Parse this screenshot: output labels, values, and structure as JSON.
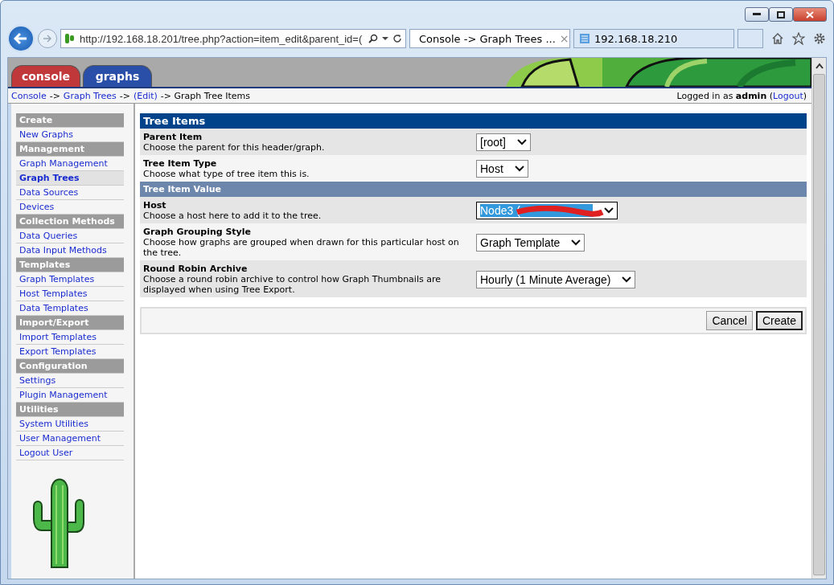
{
  "browser": {
    "address": "http://192.168.18.201/tree.php?action=item_edit&parent_id=(",
    "tabs": [
      {
        "title": "Console -> Graph Trees ...",
        "selected": true,
        "close": "×"
      },
      {
        "title": "192.168.18.210",
        "selected": false
      }
    ]
  },
  "header_tabs": [
    {
      "label": "console",
      "color": "#c0383a"
    },
    {
      "label": "graphs",
      "color": "#2a4fa8"
    }
  ],
  "breadcrumb": [
    {
      "kind": "link",
      "text": "Console"
    },
    {
      "kind": "text",
      "text": "->"
    },
    {
      "kind": "link",
      "text": "Graph Trees"
    },
    {
      "kind": "text",
      "text": "->"
    },
    {
      "kind": "link",
      "text": "(Edit)"
    },
    {
      "kind": "text",
      "text": "-> Graph Tree Items"
    }
  ],
  "login": {
    "text": "Logged in as **admin** (",
    "link": "Logout",
    "suffix": ")"
  },
  "sidebar": [
    {
      "kind": "header",
      "label": "Create"
    },
    {
      "kind": "link",
      "label": "New Graphs",
      "selected": false
    },
    {
      "kind": "header",
      "label": "Management"
    },
    {
      "kind": "link",
      "label": "Graph Management",
      "selected": false
    },
    {
      "kind": "link",
      "label": "Graph Trees",
      "selected": true
    },
    {
      "kind": "link",
      "label": "Data Sources",
      "selected": false
    },
    {
      "kind": "link",
      "label": "Devices",
      "selected": false
    },
    {
      "kind": "header",
      "label": "Collection Methods"
    },
    {
      "kind": "link",
      "label": "Data Queries",
      "selected": false
    },
    {
      "kind": "link",
      "label": "Data Input Methods",
      "selected": false
    },
    {
      "kind": "header",
      "label": "Templates"
    },
    {
      "kind": "link",
      "label": "Graph Templates",
      "selected": false
    },
    {
      "kind": "link",
      "label": "Host Templates",
      "selected": false
    },
    {
      "kind": "link",
      "label": "Data Templates",
      "selected": false
    },
    {
      "kind": "header",
      "label": "Import/Export"
    },
    {
      "kind": "link",
      "label": "Import Templates",
      "selected": false
    },
    {
      "kind": "link",
      "label": "Export Templates",
      "selected": false
    },
    {
      "kind": "header",
      "label": "Configuration"
    },
    {
      "kind": "link",
      "label": "Settings",
      "selected": false
    },
    {
      "kind": "link",
      "label": "Plugin Management",
      "selected": false
    },
    {
      "kind": "header",
      "label": "Utilities"
    },
    {
      "kind": "link",
      "label": "System Utilities",
      "selected": false
    },
    {
      "kind": "link",
      "label": "User Management",
      "selected": false
    },
    {
      "kind": "link",
      "label": "Logout User",
      "selected": false
    }
  ],
  "form": {
    "title": "Tree Items",
    "rows": [
      {
        "kind": "field",
        "label": "Parent Item",
        "description": "Choose the parent for this header/graph.",
        "value": "[root]",
        "focused": false,
        "shaded": true
      },
      {
        "kind": "field",
        "label": "Tree Item Type",
        "description": "Choose what type of tree item this is.",
        "value": "Host",
        "focused": false,
        "shaded": false
      },
      {
        "kind": "section",
        "label": "Tree Item Value"
      },
      {
        "kind": "field",
        "label": "Host",
        "description": "Choose a host here to add it to the tree.",
        "value": "Node3 (",
        "focused": true,
        "redacted": true,
        "shaded": true
      },
      {
        "kind": "field",
        "label": "Graph Grouping Style",
        "description": "Choose how graphs are grouped when drawn for this particular host on the tree.",
        "value": "Graph Template",
        "focused": false,
        "shaded": false
      },
      {
        "kind": "field",
        "label": "Round Robin Archive",
        "description": "Choose a round robin archive to control how Graph Thumbnails are displayed when using Tree Export.",
        "value": "Hourly (1 Minute Average)",
        "focused": false,
        "shaded": true
      }
    ],
    "buttons": [
      {
        "label": "Cancel",
        "default": false
      },
      {
        "label": "Create",
        "default": true
      }
    ]
  }
}
